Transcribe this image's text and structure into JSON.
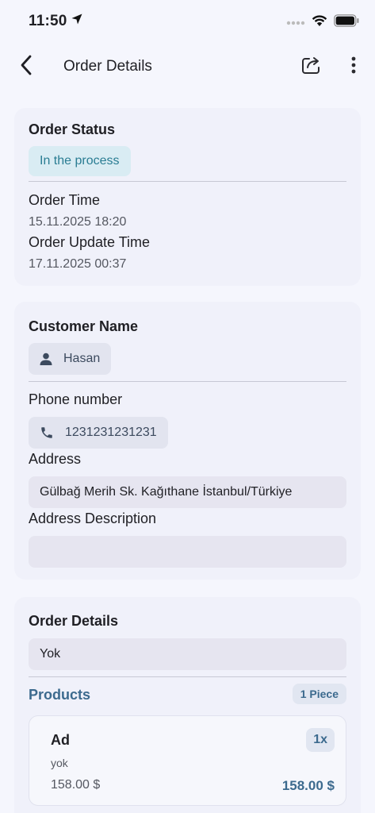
{
  "status_bar": {
    "time": "11:50"
  },
  "appbar": {
    "title": "Order Details"
  },
  "order_status_card": {
    "status_label": "Order Status",
    "status_value": "In the process",
    "order_time_label": "Order Time",
    "order_time_value": "15.11.2025 18:20",
    "update_time_label": "Order Update Time",
    "update_time_value": "17.11.2025 00:37"
  },
  "customer_card": {
    "name_label": "Customer Name",
    "name_value": "Hasan",
    "phone_label": "Phone number",
    "phone_value": "1231231231231",
    "address_label": "Address",
    "address_value": "Gülbağ Merih Sk. Kağıthane İstanbul/Türkiye",
    "address_desc_label": "Address Description",
    "address_desc_value": ""
  },
  "details_card": {
    "title": "Order Details",
    "note_value": "Yok",
    "products_label": "Products",
    "piece_count": "1 Piece",
    "products": [
      {
        "name": "Ad",
        "note": "yok",
        "quantity": "1x",
        "unit_price": "158.00 $",
        "total_price": "158.00 $"
      }
    ]
  },
  "colors": {
    "accent": "#3c6a8e",
    "status_chip_bg": "#d9ecf3",
    "status_chip_text": "#2a7d93",
    "background": "#f5f6fd"
  }
}
